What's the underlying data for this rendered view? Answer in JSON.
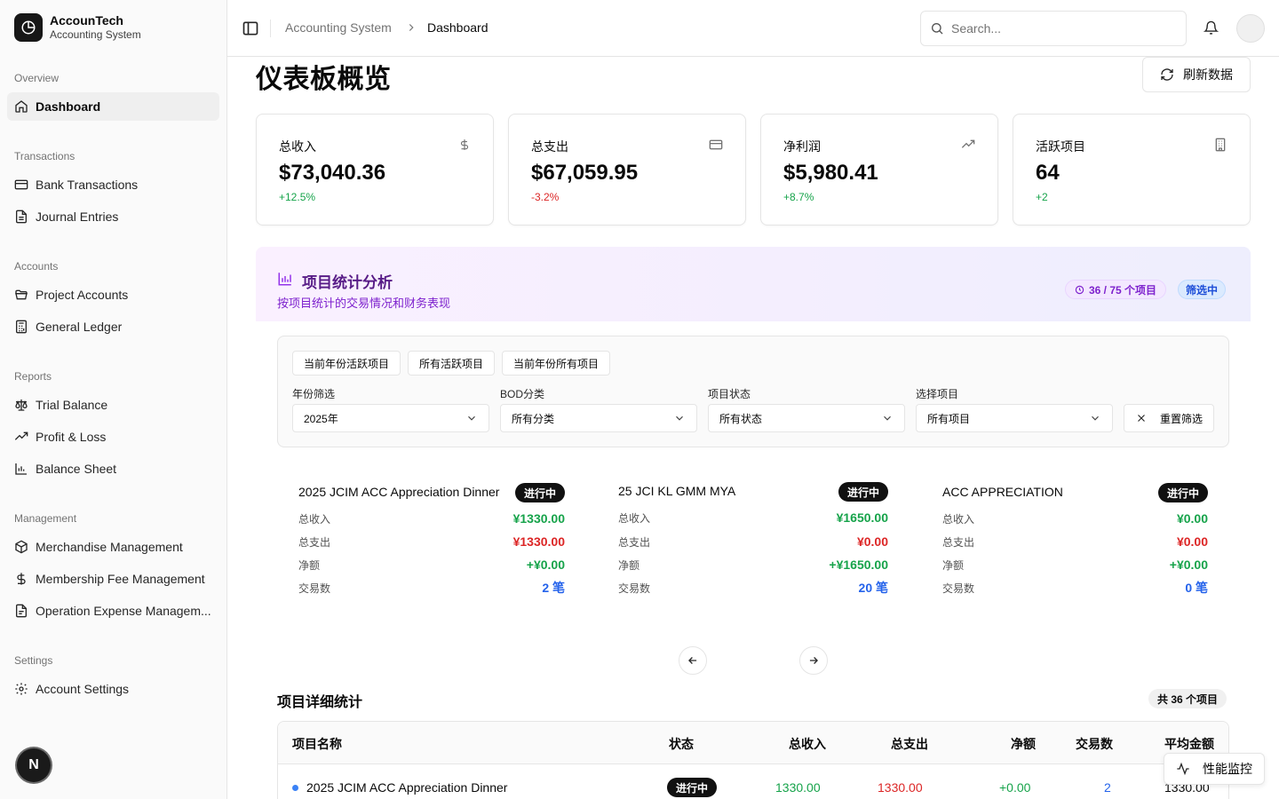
{
  "brand": {
    "name": "AccounTech",
    "subtitle": "Accounting System"
  },
  "sidebar": {
    "groups": [
      {
        "label": "Overview"
      },
      {
        "label": "Transactions"
      },
      {
        "label": "Accounts"
      },
      {
        "label": "Reports"
      },
      {
        "label": "Management"
      },
      {
        "label": "Settings"
      }
    ],
    "items": [
      {
        "label": "Dashboard",
        "icon": "home-icon",
        "active": true
      },
      {
        "label": "Bank Transactions",
        "icon": "credit-card-icon"
      },
      {
        "label": "Journal Entries",
        "icon": "file-text-icon"
      },
      {
        "label": "Project Accounts",
        "icon": "folder-open-icon"
      },
      {
        "label": "General Ledger",
        "icon": "calculator-icon"
      },
      {
        "label": "Trial Balance",
        "icon": "scale-icon"
      },
      {
        "label": "Profit & Loss",
        "icon": "trending-up-icon"
      },
      {
        "label": "Balance Sheet",
        "icon": "bar-chart-icon"
      },
      {
        "label": "Merchandise Management",
        "icon": "package-icon"
      },
      {
        "label": "Membership Fee Management",
        "icon": "dollar-sign-icon"
      },
      {
        "label": "Operation Expense Managem...",
        "icon": "file-icon"
      },
      {
        "label": "Account Settings",
        "icon": "gear-icon"
      }
    ],
    "user_initial": "N"
  },
  "header": {
    "breadcrumb": [
      "Accounting System",
      "Dashboard"
    ],
    "search_placeholder": "Search..."
  },
  "page": {
    "title": "仪表板概览",
    "refresh_label": "刷新数据"
  },
  "stats": [
    {
      "label": "总收入",
      "value": "$73,040.36",
      "change": "+12.5%",
      "icon": "dollar-icon",
      "color": "#16a34a"
    },
    {
      "label": "总支出",
      "value": "$67,059.95",
      "change": "-3.2%",
      "icon": "credit-card-icon",
      "color": "#dc2626"
    },
    {
      "label": "净利润",
      "value": "$5,980.41",
      "change": "+8.7%",
      "icon": "trending-up-icon",
      "color": "#16a34a"
    },
    {
      "label": "活跃项目",
      "value": "64",
      "change": "+2",
      "icon": "building-icon",
      "color": "#16a34a"
    }
  ],
  "analysis": {
    "title": "项目统计分析",
    "subtitle": "按项目统计的交易情况和财务表现",
    "count_badge": "36 / 75 个项目",
    "filter_badge": "筛选中"
  },
  "filters": {
    "quick": [
      "当前年份活跃项目",
      "所有活跃项目",
      "当前年份所有项目"
    ],
    "fields": [
      {
        "label": "年份筛选",
        "value": "2025年"
      },
      {
        "label": "BOD分类",
        "value": "所有分类"
      },
      {
        "label": "项目状态",
        "value": "所有状态"
      },
      {
        "label": "选择项目",
        "value": "所有项目"
      }
    ],
    "reset_label": "重置筛选"
  },
  "project_cards": [
    {
      "name": "2025 JCIM ACC Appreciation Dinner",
      "status": "进行中",
      "income": "¥1330.00",
      "expense": "¥1330.00",
      "net": "+¥0.00",
      "count": "2 笔"
    },
    {
      "name": "25 JCI KL GMM MYA",
      "status": "进行中",
      "income": "¥1650.00",
      "expense": "¥0.00",
      "net": "+¥1650.00",
      "count": "20 笔"
    },
    {
      "name": "ACC APPRECIATION",
      "status": "进行中",
      "income": "¥0.00",
      "expense": "¥0.00",
      "net": "+¥0.00",
      "count": "0 笔"
    }
  ],
  "card_labels": {
    "income": "总收入",
    "expense": "总支出",
    "net": "净额",
    "count": "交易数"
  },
  "detail": {
    "title": "项目详细统计",
    "total_badge": "共 36 个项目",
    "columns": [
      "项目名称",
      "状态",
      "总收入",
      "总支出",
      "净额",
      "交易数",
      "平均金额"
    ],
    "rows": [
      {
        "name": "2025 JCIM ACC Appreciation Dinner",
        "status": "进行中",
        "income": "1330.00",
        "expense": "1330.00",
        "net": "+0.00",
        "count": "2",
        "avg": "1330.00"
      }
    ]
  },
  "perf_button": "性能监控"
}
